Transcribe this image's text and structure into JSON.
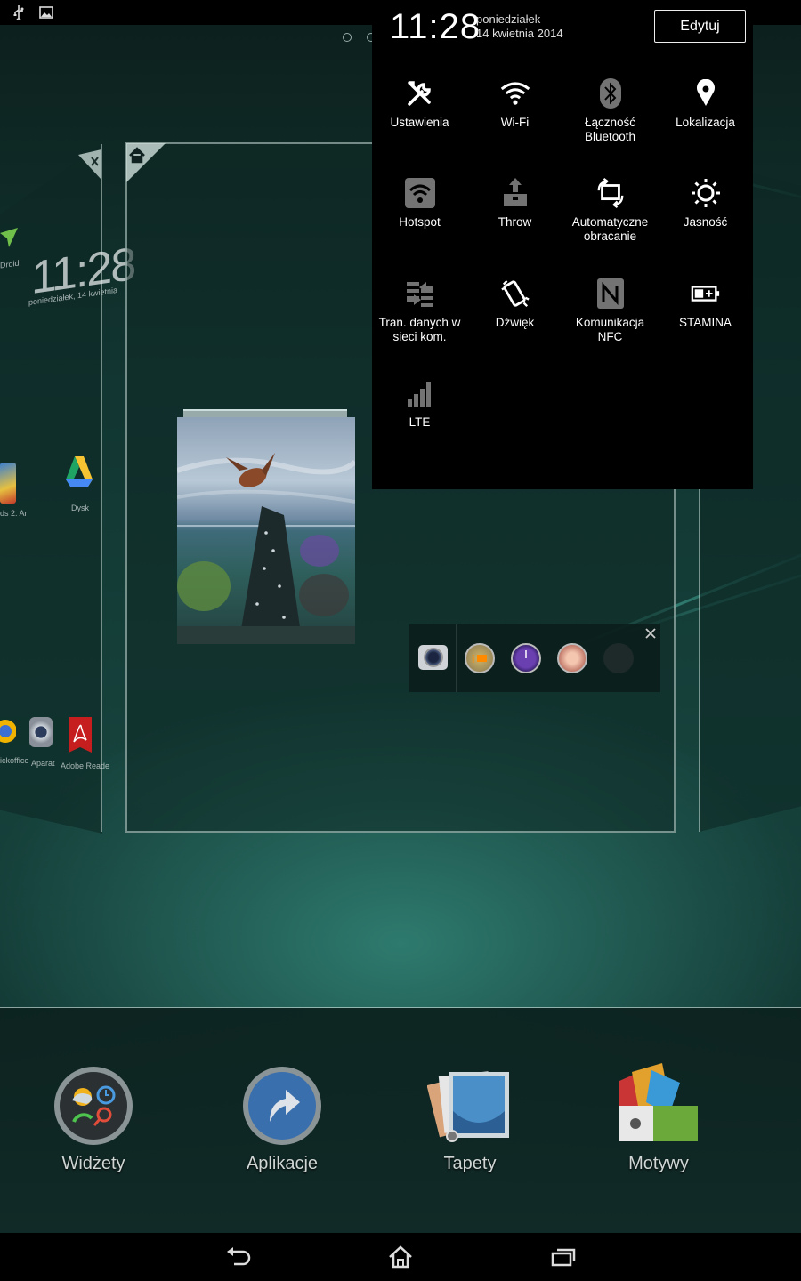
{
  "status_bar": {
    "icons": [
      "usb-icon",
      "image-icon"
    ]
  },
  "quick_settings": {
    "time": "11:28",
    "day": "poniedziałek",
    "date": "14 kwietnia 2014",
    "edit_label": "Edytuj",
    "tiles": [
      {
        "label": "Ustawienia",
        "icon": "settings-tools-icon",
        "state": "on"
      },
      {
        "label": "Wi-Fi",
        "icon": "wifi-icon",
        "state": "on"
      },
      {
        "label": "Łączność Bluetooth",
        "icon": "bluetooth-icon",
        "state": "off"
      },
      {
        "label": "Lokalizacja",
        "icon": "location-icon",
        "state": "on"
      },
      {
        "label": "Hotspot",
        "icon": "hotspot-icon",
        "state": "off"
      },
      {
        "label": "Throw",
        "icon": "throw-icon",
        "state": "off"
      },
      {
        "label": "Automatyczne obracanie",
        "icon": "rotate-icon",
        "state": "on"
      },
      {
        "label": "Jasność",
        "icon": "brightness-icon",
        "state": "on"
      },
      {
        "label": "Tran. danych w sieci kom.",
        "icon": "mobile-data-icon",
        "state": "off"
      },
      {
        "label": "Dźwięk",
        "icon": "vibrate-icon",
        "state": "on"
      },
      {
        "label": "Komunikacja NFC",
        "icon": "nfc-icon",
        "state": "off"
      },
      {
        "label": "STAMINA",
        "icon": "battery-stamina-icon",
        "state": "on"
      },
      {
        "label": "LTE",
        "icon": "lte-signal-icon",
        "state": "off"
      }
    ]
  },
  "left_screen": {
    "clock": "11:28",
    "date": "poniedziałek, 14 kwietnia",
    "labels": {
      "droid": "Droid",
      "drive": "Dysk",
      "office": "ickoffice",
      "camera": "Aparat",
      "adobe": "Adobe Reade",
      "game": "ds 2: Ar"
    }
  },
  "dock": {
    "items": [
      {
        "label": "Widżety",
        "icon": "widgets-icon"
      },
      {
        "label": "Aplikacje",
        "icon": "apps-icon"
      },
      {
        "label": "Tapety",
        "icon": "wallpapers-icon"
      },
      {
        "label": "Motywy",
        "icon": "themes-icon"
      }
    ]
  },
  "nav": {
    "icons": [
      "back-icon",
      "home-icon",
      "recents-icon"
    ]
  },
  "colors": {
    "background": "#16423c",
    "panel": "#000000",
    "accent": "#2e7a6e"
  }
}
